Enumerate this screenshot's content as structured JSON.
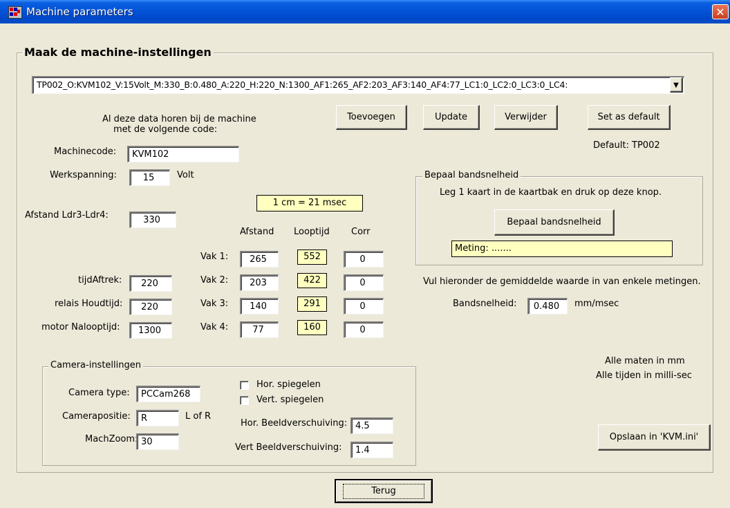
{
  "window": {
    "title": "Machine parameters",
    "close_glyph": "✕"
  },
  "main_group": {
    "title": "Maak de machine-instellingen"
  },
  "profile_select": {
    "value": "TP002_O:KVM102_V:15Volt_M:330_B:0.480_A:220_H:220_N:1300_AF1:265_AF2:203_AF3:140_AF4:77_LC1:0_LC2:0_LC3:0_LC4:",
    "arrow": "▼"
  },
  "info": {
    "line1": "Al deze data horen bij de machine",
    "line2": "met de volgende code:"
  },
  "buttons": {
    "add": "Toevoegen",
    "update": "Update",
    "delete": "Verwijder",
    "set_default": "Set as default",
    "save": "Opslaan in 'KVM.ini'",
    "back": "Terug"
  },
  "default_text": "Default: TP002",
  "fields": {
    "machinecode": {
      "label": "Machinecode:",
      "value": "KVM102"
    },
    "werkspanning": {
      "label": "Werkspanning:",
      "value": "15",
      "unit": "Volt"
    },
    "afstand_ldr": {
      "label": "Afstand Ldr3-Ldr4:",
      "value": "330"
    },
    "tijdaftrek": {
      "label": "tijdAftrek:",
      "value": "220"
    },
    "houdtijd": {
      "label": "relais Houdtijd:",
      "value": "220"
    },
    "nalooptijd": {
      "label": "motor Nalooptijd:",
      "value": "1300"
    }
  },
  "scale_box": "1 cm = 21 msec",
  "vak_table": {
    "headers": {
      "afstand": "Afstand",
      "looptijd": "Looptijd",
      "corr": "Corr"
    },
    "rows": [
      {
        "label": "Vak 1:",
        "afstand": "265",
        "looptijd": "552",
        "corr": "0"
      },
      {
        "label": "Vak 2:",
        "afstand": "203",
        "looptijd": "422",
        "corr": "0"
      },
      {
        "label": "Vak 3:",
        "afstand": "140",
        "looptijd": "291",
        "corr": "0"
      },
      {
        "label": "Vak 4:",
        "afstand": "77",
        "looptijd": "160",
        "corr": "0"
      }
    ]
  },
  "band_group": {
    "title": "Bepaal bandsnelheid",
    "instruction": "Leg 1 kaart in de kaartbak en druk op deze knop.",
    "button": "Bepaal bandsnelheid",
    "meting": "Meting: ......."
  },
  "average_text": "Vul hieronder de gemiddelde waarde in van enkele metingen.",
  "bandsnelheid": {
    "label": "Bandsnelheid:",
    "value": "0.480",
    "unit": "mm/msec"
  },
  "units_note": {
    "line1": "Alle maten in mm",
    "line2": "Alle tijden in milli-sec"
  },
  "camera": {
    "title": "Camera-instellingen",
    "type": {
      "label": "Camera type:",
      "value": "PCCam268"
    },
    "positie": {
      "label": "Camerapositie:",
      "value": "R",
      "hint": "L of R"
    },
    "zoom": {
      "label": "MachZoom:",
      "value": "30"
    },
    "hor_mirror": {
      "label": "Hor. spiegelen",
      "checked": false
    },
    "vert_mirror": {
      "label": "Vert. spiegelen",
      "checked": false
    },
    "hor_shift": {
      "label": "Hor. Beeldverschuiving:",
      "value": "4.5"
    },
    "vert_shift": {
      "label": "Vert Beeldverschuiving:",
      "value": "1.4"
    }
  },
  "colors": {
    "titlebar": "#0352d6",
    "highlight_box": "#ffffc0",
    "window_bg": "#ece9d8"
  }
}
